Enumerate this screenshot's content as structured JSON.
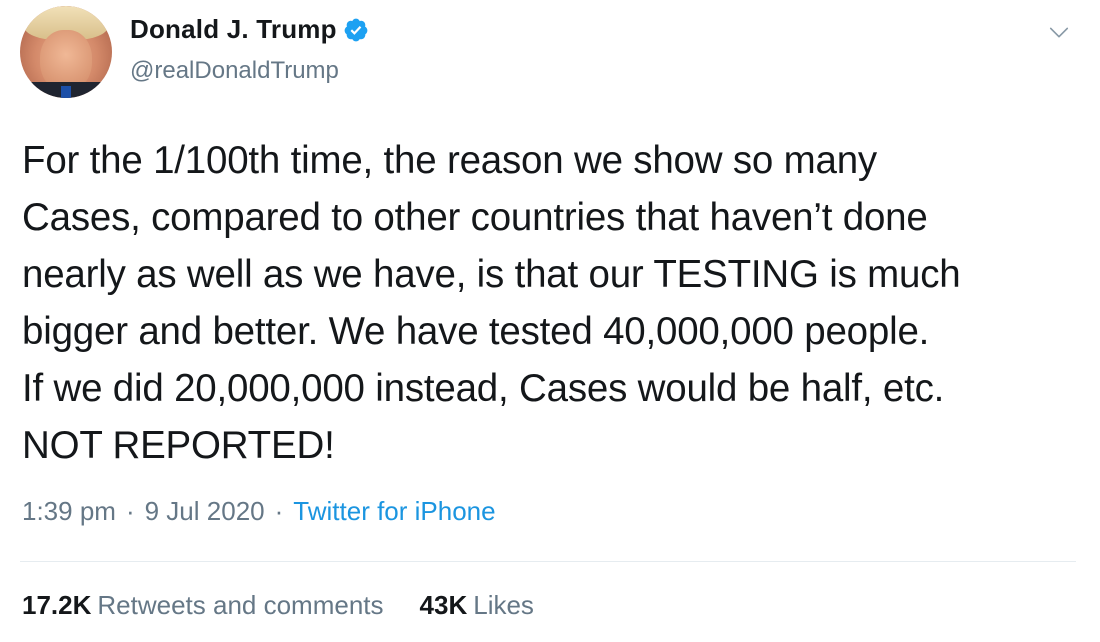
{
  "user": {
    "display_name": "Donald J. Trump",
    "handle": "@realDonaldTrump",
    "verified": true
  },
  "icons": {
    "verified": "verified-badge-icon",
    "menu": "chevron-down-icon",
    "avatar": "profile-photo"
  },
  "tweet": {
    "lines": [
      "For the 1/100th time, the reason we show so many",
      "Cases, compared to other countries that haven’t done",
      "nearly as well as we have, is that our TESTING is much",
      "bigger and better. We have tested 40,000,000 people.",
      "If we did 20,000,000 instead, Cases would be half, etc.",
      "NOT REPORTED!"
    ]
  },
  "meta": {
    "time": "1:39 pm",
    "sep1": "·",
    "date": "9 Jul 2020",
    "sep2": "·",
    "source": "Twitter for iPhone"
  },
  "stats": {
    "retweets_count": "17.2K",
    "retweets_label": "Retweets and comments",
    "likes_count": "43K",
    "likes_label": "Likes"
  },
  "colors": {
    "text": "#14171a",
    "secondary": "#657786",
    "link": "#1b95e0",
    "verified": "#1da1f2",
    "divider": "#e6ecf0"
  }
}
